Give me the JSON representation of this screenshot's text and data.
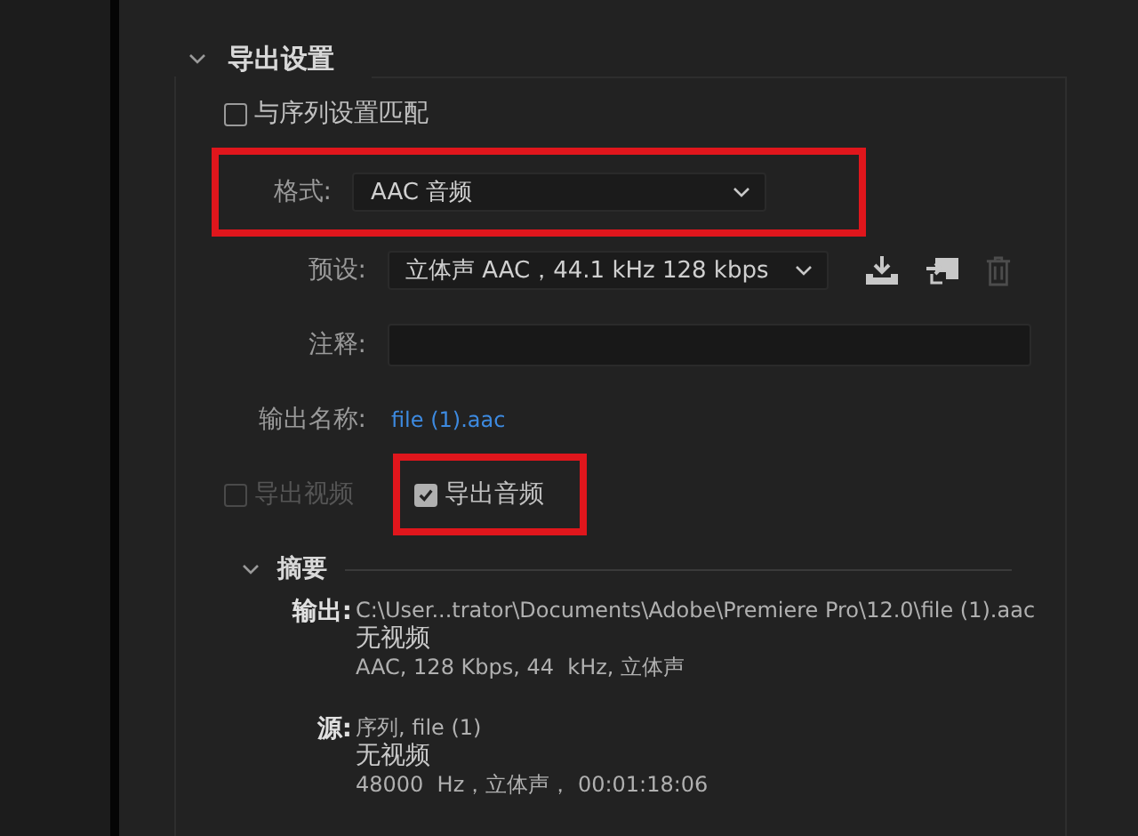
{
  "section": {
    "title": "导出设置",
    "expanded": true
  },
  "match_sequence": {
    "label": "与序列设置匹配",
    "checked": false
  },
  "format": {
    "label": "格式:",
    "value": "AAC 音频",
    "highlighted": true
  },
  "preset": {
    "label": "预设:",
    "value": "立体声 AAC，44.1 kHz 128 kbps"
  },
  "comment": {
    "label": "注释:"
  },
  "output_name": {
    "label": "输出名称:",
    "value": "file (1).aac"
  },
  "export_options": [
    {
      "label": "导出视频",
      "checked": false,
      "disabled": true,
      "highlighted": false
    },
    {
      "label": "导出音频",
      "checked": true,
      "disabled": false,
      "highlighted": true
    }
  ],
  "summary": {
    "title": "摘要",
    "expanded": true,
    "entries": [
      {
        "label": "输出:",
        "lines": [
          "C:\\User...trator\\Documents\\Adobe\\Premiere Pro\\12.0\\file (1).aac",
          "无视频",
          "AAC, 128 Kbps, 44  kHz, 立体声"
        ]
      },
      {
        "label": "源:",
        "lines": [
          "序列, file (1)",
          "无视频",
          "48000  Hz，立体声， 00:01:18:06"
        ]
      }
    ]
  }
}
